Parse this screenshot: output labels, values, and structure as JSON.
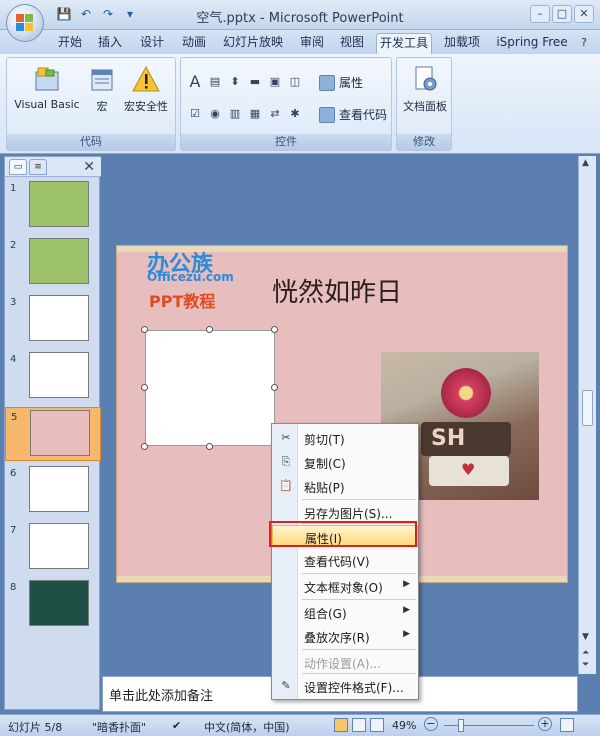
{
  "window": {
    "title": "空气.pptx - Microsoft PowerPoint",
    "min": "–",
    "max": "□",
    "close": "✕"
  },
  "qat": {
    "save": "💾",
    "undo": "↶",
    "redo": "↷",
    "more": "▾"
  },
  "tabs": [
    {
      "label": "开始"
    },
    {
      "label": "插入"
    },
    {
      "label": "设计"
    },
    {
      "label": "动画"
    },
    {
      "label": "幻灯片放映"
    },
    {
      "label": "审阅"
    },
    {
      "label": "视图"
    },
    {
      "label": "开发工具",
      "active": true
    },
    {
      "label": "加载项"
    },
    {
      "label": "iSpring Free"
    }
  ],
  "ribbon": {
    "code_group": {
      "label": "代码",
      "vb": "Visual Basic",
      "macro": "宏",
      "security": "宏安全性"
    },
    "controls_group": {
      "label": "控件",
      "properties": "属性",
      "view_code": "查看代码"
    },
    "modify_group": {
      "label": "修改",
      "doc_panel": "文档面板"
    }
  },
  "left_pane": {
    "slides": [
      {
        "num": "1",
        "color": "#9ec26a"
      },
      {
        "num": "2",
        "color": "#9ec26a"
      },
      {
        "num": "3",
        "color": "#ffffff"
      },
      {
        "num": "4",
        "color": "#ffffff"
      },
      {
        "num": "5",
        "color": "#e7bdbd",
        "selected": true
      },
      {
        "num": "6",
        "color": "#ffffff"
      },
      {
        "num": "7",
        "color": "#ffffff"
      },
      {
        "num": "8",
        "color": "#1f4f45"
      }
    ]
  },
  "slide": {
    "title": "恍然如昨日",
    "watermark": {
      "brand": "办公族",
      "domain": "Officezu.com",
      "tag": "PPT教程"
    }
  },
  "context_menu": {
    "items": [
      {
        "label": "剪切(T)",
        "icon": "scissors-icon",
        "glyph": "✂"
      },
      {
        "label": "复制(C)",
        "icon": "copy-icon",
        "glyph": "⎘"
      },
      {
        "label": "粘贴(P)",
        "icon": "paste-icon",
        "glyph": "📋"
      },
      {
        "label": "另存为图片(S)..."
      },
      {
        "label": "属性(I)",
        "highlighted": true
      },
      {
        "label": "查看代码(V)"
      },
      {
        "label": "文本框对象(O)",
        "submenu": true
      },
      {
        "label": "组合(G)",
        "submenu": true
      },
      {
        "label": "叠放次序(R)",
        "submenu": true
      },
      {
        "label": "动作设置(A)...",
        "disabled": true
      },
      {
        "label": "设置控件格式(F)...",
        "icon": "format-icon",
        "glyph": "✎"
      }
    ]
  },
  "notes": {
    "placeholder": "单击此处添加备注"
  },
  "status": {
    "slide_info": "幻灯片 5/8",
    "theme": "\"暗香扑面\"",
    "language": "中文(简体，中国)",
    "zoom": "49%",
    "minus": "−",
    "plus": "+"
  }
}
